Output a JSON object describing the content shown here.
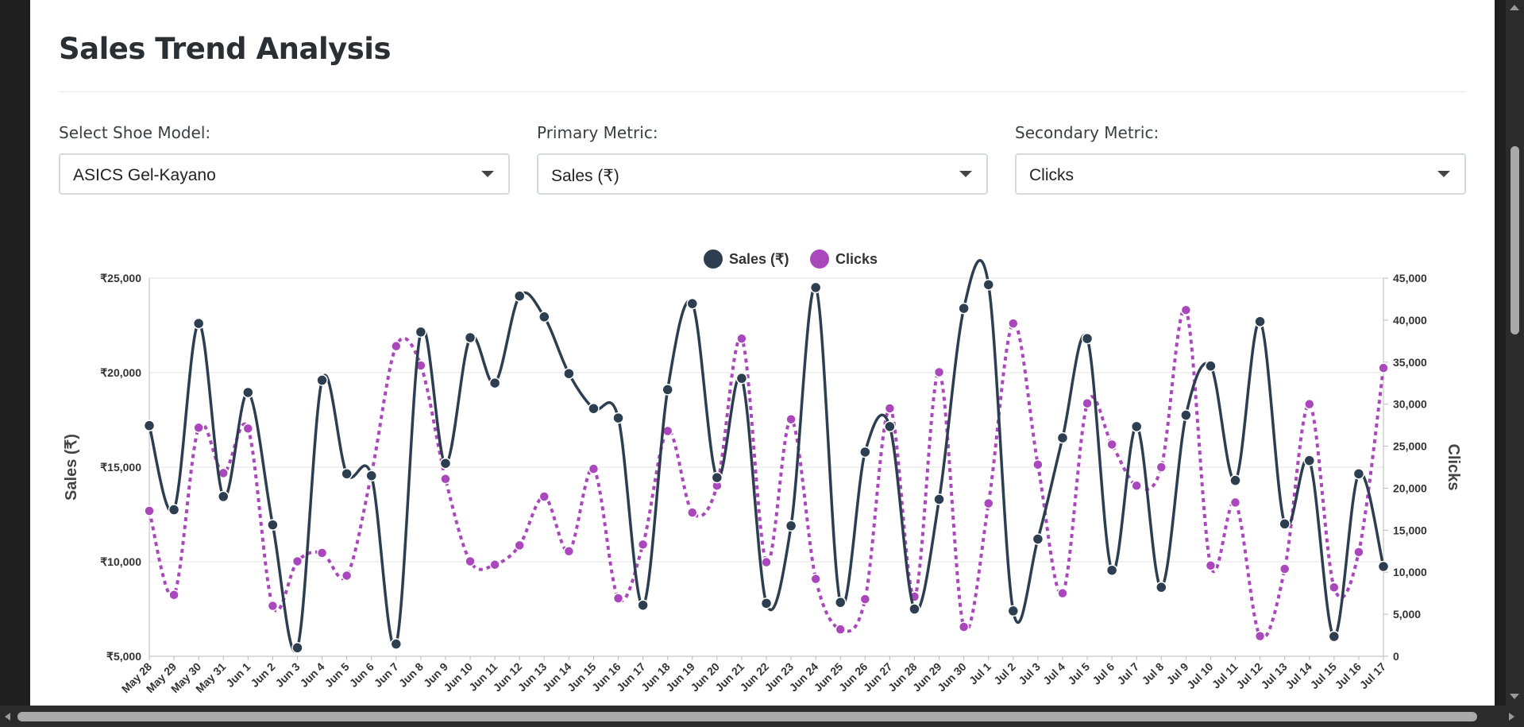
{
  "page": {
    "title": "Sales Trend Analysis"
  },
  "controls": [
    {
      "label": "Select Shoe Model:",
      "value": "ASICS Gel-Kayano"
    },
    {
      "label": "Primary Metric:",
      "value": "Sales (₹)"
    },
    {
      "label": "Secondary Metric:",
      "value": "Clicks"
    }
  ],
  "icons": {
    "dropdown": "chevron-down-icon",
    "legend_marker": "circle-icon"
  },
  "chart_data": {
    "type": "line",
    "title": "",
    "categories": [
      "May 28",
      "May 29",
      "May 30",
      "May 31",
      "Jun 1",
      "Jun 2",
      "Jun 3",
      "Jun 4",
      "Jun 5",
      "Jun 6",
      "Jun 7",
      "Jun 8",
      "Jun 9",
      "Jun 10",
      "Jun 11",
      "Jun 12",
      "Jun 13",
      "Jun 14",
      "Jun 15",
      "Jun 16",
      "Jun 17",
      "Jun 18",
      "Jun 19",
      "Jun 20",
      "Jun 21",
      "Jun 22",
      "Jun 23",
      "Jun 24",
      "Jun 25",
      "Jun 26",
      "Jun 27",
      "Jun 28",
      "Jun 29",
      "Jun 30",
      "Jul 1",
      "Jul 2",
      "Jul 3",
      "Jul 4",
      "Jul 5",
      "Jul 6",
      "Jul 7",
      "Jul 8",
      "Jul 9",
      "Jul 10",
      "Jul 11",
      "Jul 12",
      "Jul 13",
      "Jul 14",
      "Jul 15",
      "Jul 16",
      "Jul 17"
    ],
    "xlabel": "",
    "y_left_label": "Sales (₹)",
    "y_right_label": "Clicks",
    "y_left_ticks": [
      "₹5,000",
      "₹10,000",
      "₹15,000",
      "₹20,000",
      "₹25,000"
    ],
    "y_right_ticks": [
      "0",
      "5,000",
      "10,000",
      "15,000",
      "20,000",
      "25,000",
      "30,000",
      "35,000",
      "40,000",
      "45,000"
    ],
    "ylim_left": [
      5000,
      25000
    ],
    "ylim_right": [
      0,
      45000
    ],
    "grid": true,
    "legend_position": "top-center",
    "series": [
      {
        "name": "Sales (₹)",
        "axis": "left",
        "color": "#2c3e50",
        "style": "solid",
        "values": [
          17200,
          12750,
          22600,
          13450,
          18950,
          11950,
          5450,
          19600,
          14650,
          14550,
          5650,
          22150,
          15200,
          21850,
          19450,
          24050,
          22950,
          19950,
          18100,
          17600,
          7700,
          19100,
          23650,
          14450,
          19700,
          7800,
          11900,
          24500,
          7850,
          15800,
          17150,
          7500,
          13300,
          23400,
          24650,
          7400,
          11200,
          16550,
          21800,
          9550,
          17150,
          8650,
          17750,
          20350,
          14300,
          22700,
          12000,
          15350,
          6050,
          14650,
          9750
        ]
      },
      {
        "name": "Clicks",
        "axis": "right",
        "color": "#ab47bc",
        "style": "dotted",
        "values": [
          17300,
          7300,
          27200,
          21800,
          27100,
          6000,
          11300,
          12300,
          9600,
          21700,
          36900,
          34600,
          21100,
          11300,
          10900,
          13200,
          19000,
          12500,
          22300,
          6900,
          13300,
          26800,
          17100,
          20300,
          37800,
          11200,
          28200,
          9200,
          3200,
          6800,
          29500,
          7100,
          33800,
          3500,
          18200,
          39600,
          22800,
          7500,
          30100,
          25200,
          20300,
          22500,
          41200,
          10800,
          18300,
          2400,
          10400,
          30000,
          8200,
          12400,
          34300
        ]
      }
    ]
  }
}
